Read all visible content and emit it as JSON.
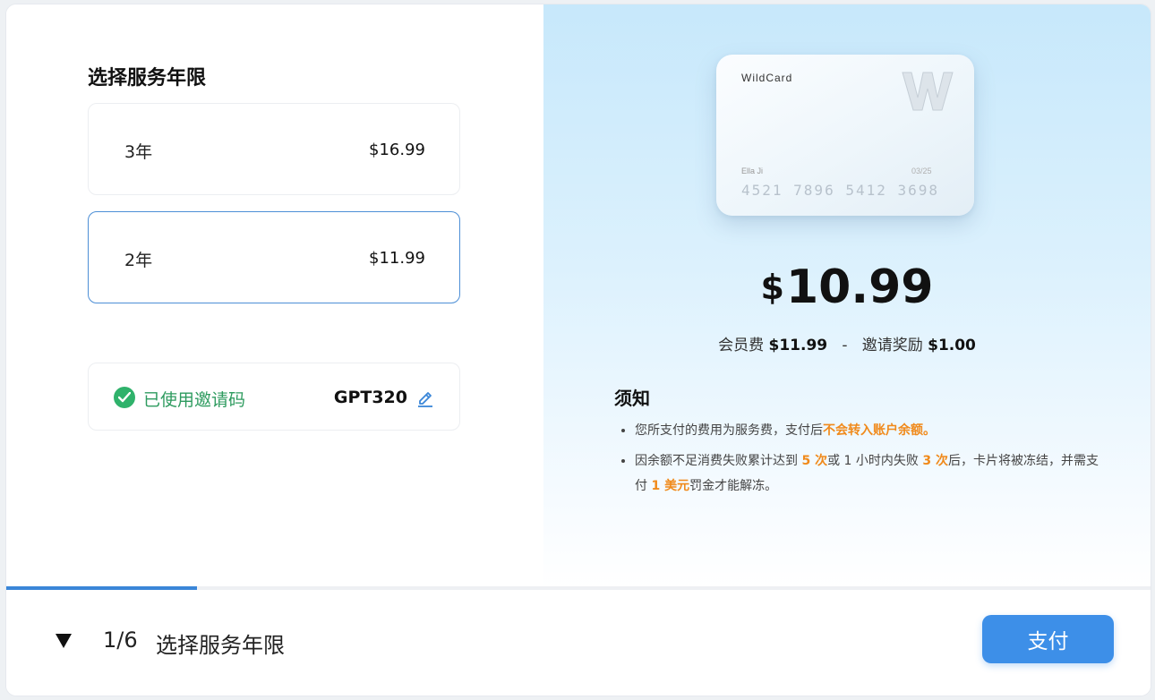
{
  "left": {
    "section_title": "选择服务年限",
    "options": [
      {
        "name": "3年",
        "price": "$16.99",
        "selected": false
      },
      {
        "name": "2年",
        "price": "$11.99",
        "selected": true
      }
    ],
    "invite": {
      "label": "已使用邀请码",
      "code": "GPT320",
      "status_color": "#2fb26b"
    }
  },
  "right": {
    "card": {
      "brand": "WildCard",
      "holder": "Ella Ji",
      "expiry": "03/25",
      "number": "4521  7896  5412  3698"
    },
    "total": {
      "currency": "$",
      "amount": "10.99"
    },
    "breakdown": {
      "fee_label": "会员费",
      "fee_value": "$11.99",
      "separator": "-",
      "reward_label": "邀请奖励",
      "reward_value": "$1.00"
    },
    "notice": {
      "title": "须知",
      "item1_text": "您所支付的费用为服务费，支付后",
      "item1_highlight": "不会转入账户余额。",
      "item2_part1": "因余额不足消费失败累计达到 ",
      "item2_hl1": "5 次",
      "item2_part2": "或 1 小时内失败 ",
      "item2_hl2": "3 次",
      "item2_part3": "后，卡片将被冻结，并需支付 ",
      "item2_hl3": "1 美元",
      "item2_part4": "罚金才能解冻。",
      "highlight_color": "#f08a1b"
    }
  },
  "footer": {
    "progress_fraction": 0.1667,
    "step": "1/6",
    "step_title": "选择服务年限",
    "pay_label": "支付",
    "accent_color": "#3d8fe8"
  }
}
